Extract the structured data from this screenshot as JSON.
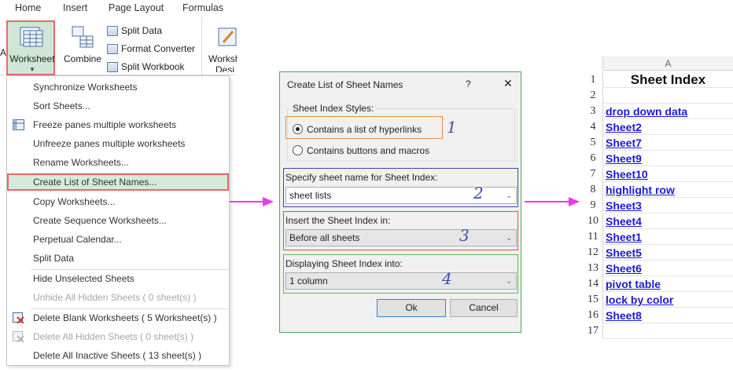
{
  "ribbon": {
    "tabs": [
      "Home",
      "Insert",
      "Page Layout",
      "Formulas"
    ],
    "worksheet_label": "Worksheet",
    "combine_label": "Combine",
    "split_data_label": "Split Data",
    "format_converter_label": "Format Converter",
    "split_workbook_label": "Split Workbook",
    "worksheet_design_label": "Worksh",
    "worksheet_design_label2": "Desi",
    "left_partial": "A"
  },
  "menu": {
    "items": [
      {
        "label": "Synchronize Worksheets",
        "icon": "none",
        "disabled": false
      },
      {
        "label": "Sort Sheets...",
        "icon": "none",
        "disabled": false
      },
      {
        "label": "Freeze panes multiple worksheets",
        "icon": "freeze-panes-icon",
        "disabled": false
      },
      {
        "label": "Unfreeze panes multiple worksheets",
        "icon": "none",
        "disabled": false
      },
      {
        "label": "Rename Worksheets...",
        "icon": "none",
        "disabled": false
      },
      {
        "label": "Create List of Sheet Names...",
        "icon": "none",
        "disabled": false
      },
      {
        "label": "Copy Worksheets...",
        "icon": "none",
        "disabled": false
      },
      {
        "label": "Create Sequence Worksheets...",
        "icon": "none",
        "disabled": false
      },
      {
        "label": "Perpetual Calendar...",
        "icon": "none",
        "disabled": false
      },
      {
        "label": "Split Data",
        "icon": "none",
        "disabled": false
      },
      {
        "label": "Hide Unselected Sheets",
        "icon": "none",
        "disabled": false
      },
      {
        "label": "Unhide All Hidden Sheets ( 0 sheet(s) )",
        "icon": "none",
        "disabled": true
      },
      {
        "label": "Delete Blank Worksheets ( 5 Worksheet(s) )",
        "icon": "delete-sheet-icon",
        "disabled": false
      },
      {
        "label": "Delete All Hidden Sheets ( 0 sheet(s) )",
        "icon": "delete-hidden-icon",
        "disabled": true
      },
      {
        "label": "Delete All Inactive Sheets ( 13 sheet(s) )",
        "icon": "none",
        "disabled": false
      }
    ]
  },
  "dialog": {
    "title": "Create List of Sheet Names",
    "help": "?",
    "close": "✕",
    "styles_group": "Sheet Index Styles:",
    "option_hyperlinks": "Contains a list of hyperlinks",
    "option_buttons": "Contains buttons and macros",
    "sheet_name_label": "Specify sheet name for Sheet Index:",
    "sheet_name_value": "sheet lists",
    "insert_label": "Insert the Sheet Index in:",
    "insert_value": "Before all sheets",
    "display_label": "Displaying Sheet Index into:",
    "display_value": "1 column",
    "ok": "Ok",
    "cancel": "Cancel",
    "step_numbers": [
      "1",
      "2",
      "3",
      "4"
    ]
  },
  "sheet": {
    "column": "A",
    "rows": [
      {
        "n": "1",
        "v": "Sheet Index"
      },
      {
        "n": "2",
        "v": ""
      },
      {
        "n": "3",
        "v": "drop down data"
      },
      {
        "n": "4",
        "v": "Sheet2"
      },
      {
        "n": "5",
        "v": "Sheet7"
      },
      {
        "n": "6",
        "v": "Sheet9"
      },
      {
        "n": "7",
        "v": "Sheet10"
      },
      {
        "n": "8",
        "v": "highlight row"
      },
      {
        "n": "9",
        "v": "Sheet3"
      },
      {
        "n": "10",
        "v": "Sheet4"
      },
      {
        "n": "11",
        "v": "Sheet1"
      },
      {
        "n": "12",
        "v": "Sheet5"
      },
      {
        "n": "13",
        "v": "Sheet6"
      },
      {
        "n": "14",
        "v": "pivot table"
      },
      {
        "n": "15",
        "v": "lock by color"
      },
      {
        "n": "16",
        "v": "Sheet8"
      },
      {
        "n": "17",
        "v": ""
      }
    ]
  },
  "colors": {
    "highlight_red": "#e8686a",
    "menu_highlight_bg": "#d5ead9",
    "arrow_magenta": "#ea3be4",
    "step_number_blue": "#3c4db3",
    "link_blue": "#1a1ad9"
  }
}
